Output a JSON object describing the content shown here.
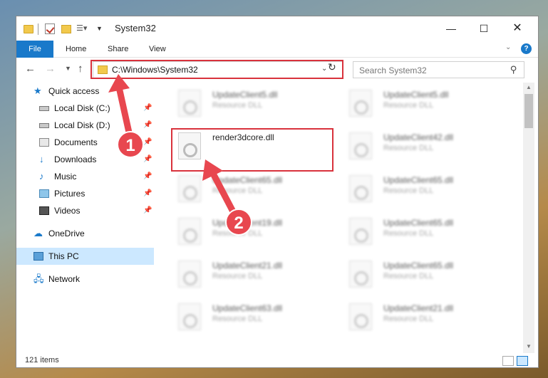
{
  "window": {
    "title": "System32",
    "minimize": "—",
    "maximize": "☐",
    "close": "✕"
  },
  "ribbon": {
    "file": "File",
    "home": "Home",
    "share": "Share",
    "view": "View"
  },
  "navigation": {
    "address": "C:\\Windows\\System32",
    "search_placeholder": "Search System32"
  },
  "sidebar": {
    "items": [
      {
        "label": "Quick access",
        "icon": "star-icon"
      },
      {
        "label": "Local Disk (C:)",
        "icon": "disk-icon"
      },
      {
        "label": "Local Disk (D:)",
        "icon": "disk-icon"
      },
      {
        "label": "Documents",
        "icon": "documents-icon"
      },
      {
        "label": "Downloads",
        "icon": "download-icon"
      },
      {
        "label": "Music",
        "icon": "music-icon"
      },
      {
        "label": "Pictures",
        "icon": "pictures-icon"
      },
      {
        "label": "Videos",
        "icon": "videos-icon"
      },
      {
        "label": "OneDrive",
        "icon": "cloud-icon"
      },
      {
        "label": "This PC",
        "icon": "computer-icon"
      },
      {
        "label": "Network",
        "icon": "network-icon"
      }
    ]
  },
  "files": {
    "highlighted": {
      "name": "render3dcore.dll"
    },
    "items": [
      {
        "name": "UpdateClient5.dll",
        "type": "Resource DLL"
      },
      {
        "name": "UpdateClient5.dll",
        "type": "Resource DLL"
      },
      {
        "name": "UpdateClient42.dll",
        "type": "Resource DLL"
      },
      {
        "name": "UpdateClient65.dll",
        "type": "Resource DLL"
      },
      {
        "name": "UpdateClient65.dll",
        "type": "Resource DLL"
      },
      {
        "name": "UpdateClient19.dll",
        "type": "Resource DLL"
      },
      {
        "name": "UpdateClient65.dll",
        "type": "Resource DLL"
      },
      {
        "name": "UpdateClient21.dll",
        "type": "Resource DLL"
      },
      {
        "name": "UpdateClient65.dll",
        "type": "Resource DLL"
      },
      {
        "name": "UpdateClient63.dll",
        "type": "Resource DLL"
      },
      {
        "name": "UpdateClient21.dll",
        "type": "Resource DLL"
      }
    ]
  },
  "status": {
    "item_count": "121 items"
  },
  "annotations": {
    "step1": "1",
    "step2": "2",
    "accent_color": "#e8474f"
  }
}
